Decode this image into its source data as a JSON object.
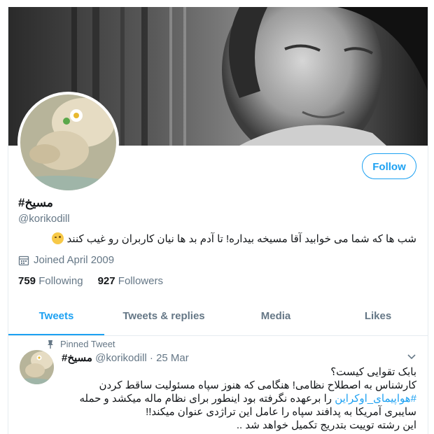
{
  "profile": {
    "display_name": "#مسیخ",
    "handle": "@korikodill",
    "bio": "شب ها که شما می خوابید آقا مسیخه بیداره!  تا آدم بد ها نیان کاربران رو غیب کنند",
    "bio_emoji": "winking-face",
    "joined": "Joined April 2009",
    "following_count": "759",
    "following_label": "Following",
    "followers_count": "927",
    "followers_label": "Followers",
    "follow_label": "Follow"
  },
  "tabs": [
    {
      "label": "Tweets",
      "active": true
    },
    {
      "label": "Tweets & replies",
      "active": false
    },
    {
      "label": "Media",
      "active": false
    },
    {
      "label": "Likes",
      "active": false
    }
  ],
  "pinned_tweet": {
    "pinned_label": "Pinned Tweet",
    "name": "#مسیخ",
    "handle": "@korikodill",
    "date": "25 Mar",
    "lines": [
      "بابک تقوایی کیست؟",
      "کارشناس به اصطلاح نظامی! هنگامی که هنوز سپاه مسئولیت ساقط کردن",
      "را برعهده نگرفته بود اینطور برای نظام ماله میکشد و حمله",
      "سایبری آمریکا به پدافند سپاه را عامل این تراژدی عنوان میکند!!",
      "این رشته توییت بتدریج تکمیل خواهد شد .."
    ],
    "hashtag": "#هواپیمای_اوکراین"
  },
  "colors": {
    "accent": "#1da1f2",
    "muted": "#657786",
    "text": "#14171a",
    "border": "#e6ecf0"
  }
}
